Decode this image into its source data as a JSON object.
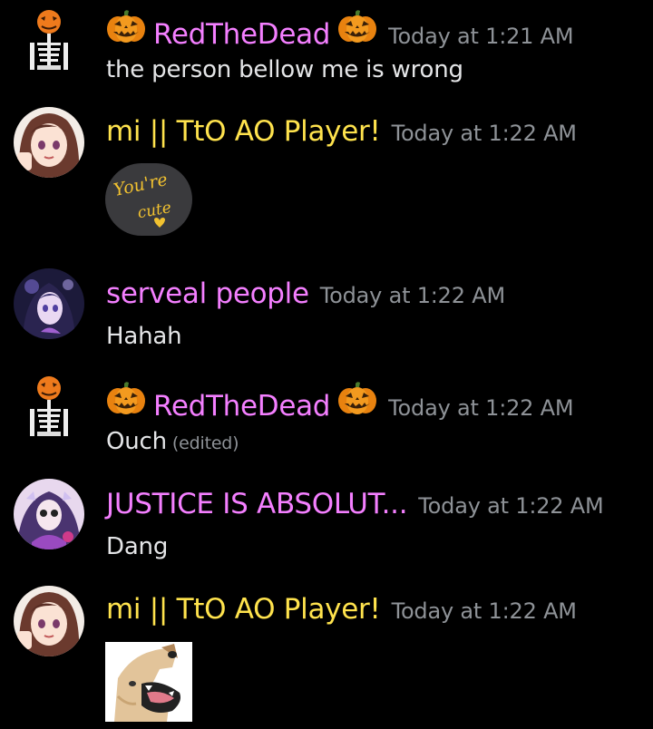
{
  "colors": {
    "background": "#000000",
    "name_red": "#f47fff",
    "name_mi": "#ffe34d",
    "name_serveal": "#f47fff",
    "name_justice": "#f47fff",
    "timestamp": "#8e9297"
  },
  "messages": [
    {
      "username": "RedTheDead",
      "avatar": "skeleton-pumpkin-avatar",
      "decorations": [
        "pumpkin-icon",
        "pumpkin-icon"
      ],
      "timestamp": "Today at 1:21 AM",
      "text": "the person bellow me is wrong"
    },
    {
      "username": "mi || TtO AO Player!",
      "avatar": "anime-girl-avatar",
      "timestamp": "Today at 1:22 AM",
      "sticker_text_1": "You're",
      "sticker_text_2": "cute"
    },
    {
      "username": "serveal people",
      "avatar": "anime-dark-avatar",
      "timestamp": "Today at 1:22 AM",
      "text": "Hahah"
    },
    {
      "username": "RedTheDead",
      "avatar": "skeleton-pumpkin-avatar",
      "decorations": [
        "pumpkin-icon",
        "pumpkin-icon"
      ],
      "timestamp": "Today at 1:22 AM",
      "text": "Ouch",
      "edited": "(edited)"
    },
    {
      "username": "JUSTICE IS ABSOLUT...",
      "avatar": "anime-purple-avatar",
      "timestamp": "Today at 1:22 AM",
      "text": "Dang"
    },
    {
      "username": "mi || TtO AO Player!",
      "avatar": "anime-girl-avatar",
      "timestamp": "Today at 1:22 AM",
      "image": "laughing-dog-image"
    }
  ]
}
